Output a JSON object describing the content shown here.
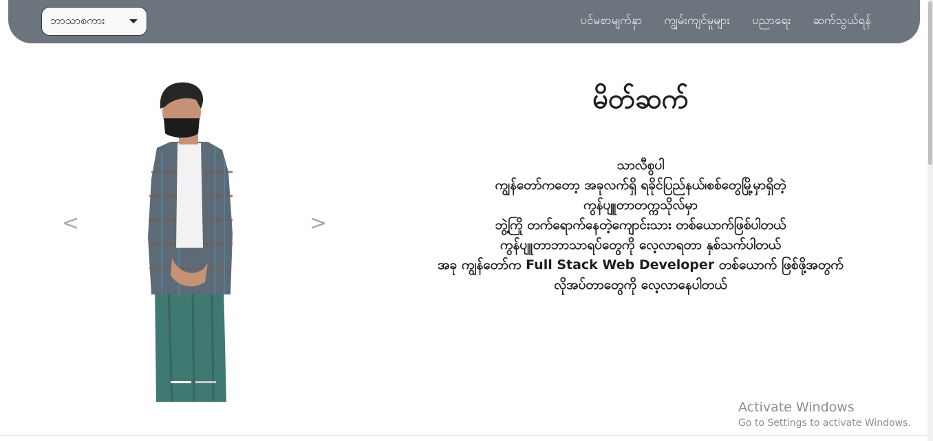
{
  "navbar": {
    "language_dropdown": {
      "selected": "ဘာသာစကား"
    },
    "links": [
      {
        "label": "ပင်မစာမျက်နှာ"
      },
      {
        "label": "ကျွမ်းကျင်မှုများ"
      },
      {
        "label": "ပညာရေး"
      },
      {
        "label": "ဆက်သွယ်ရန်"
      }
    ]
  },
  "carousel": {
    "prev_label": "<",
    "next_label": ">",
    "slide_count": 2,
    "active_slide": 1
  },
  "intro": {
    "title": "မိတ်ဆက်",
    "lines": [
      "သာလီစွပါ",
      "ကျွန်တော်ကတော့ အခုလက်ရှိ ရခိုင်ပြည်နယ်၊စစ်တွေမြို့မှာရှိတဲ့",
      "ကွန်ပျူတာတက္ကသိုလ်မှာ",
      "ဘွဲ့ကြို တက်ရောက်နေတဲ့ကျောင်းသား တစ်ယောက်ဖြစ်ပါတယ်",
      "ကွန်ပျူတာဘာသာရပ်တွေကို လေ့လာရတာ နှစ်သက်ပါတယ်",
      "အခု ကျွန်တော်က Full Stack Web Developer တစ်ယောက် ဖြစ်ဖို့အတွက်",
      "လိုအပ်တာတွေကို လေ့လာနေပါတယ်"
    ]
  },
  "watermark": {
    "title": "Activate Windows",
    "subtitle": "Go to Settings to activate Windows."
  },
  "colors": {
    "navbar_bg": "#6c757d",
    "nav_text": "#f1f3f5",
    "text": "#1e1e1e",
    "shirt": "#5d6b78",
    "longyi": "#3f7a72"
  },
  "icons": [
    "chevron-left-icon",
    "chevron-right-icon",
    "caret-down-icon"
  ]
}
